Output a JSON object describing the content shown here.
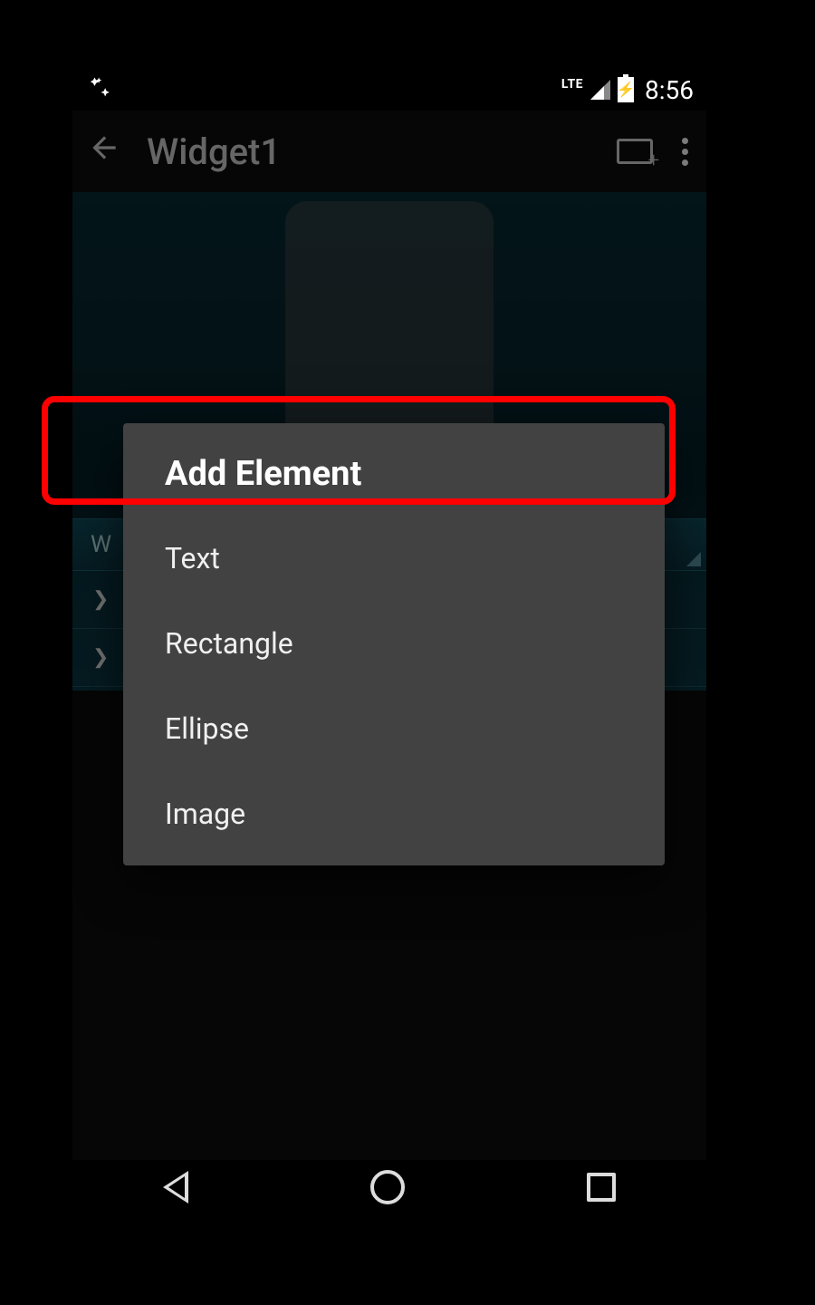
{
  "status": {
    "network_label": "LTE",
    "time": "8:56"
  },
  "app_bar": {
    "title": "Widget1"
  },
  "background_list": {
    "header_letter": "W"
  },
  "dialog": {
    "title": "Add Element",
    "items": [
      {
        "label": "Text"
      },
      {
        "label": "Rectangle"
      },
      {
        "label": "Ellipse"
      },
      {
        "label": "Image"
      }
    ]
  },
  "highlighted_item_index": 0
}
